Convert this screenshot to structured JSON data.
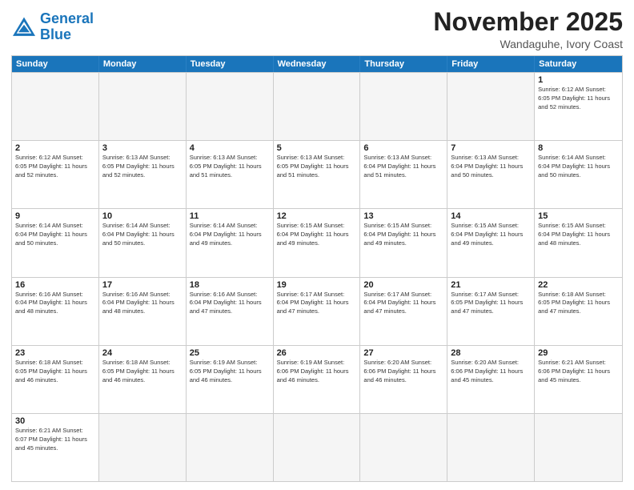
{
  "logo": {
    "line1": "General",
    "line2": "Blue"
  },
  "title": "November 2025",
  "location": "Wandaguhe, Ivory Coast",
  "days": [
    "Sunday",
    "Monday",
    "Tuesday",
    "Wednesday",
    "Thursday",
    "Friday",
    "Saturday"
  ],
  "rows": [
    [
      {
        "day": "",
        "empty": true,
        "info": ""
      },
      {
        "day": "",
        "empty": true,
        "info": ""
      },
      {
        "day": "",
        "empty": true,
        "info": ""
      },
      {
        "day": "",
        "empty": true,
        "info": ""
      },
      {
        "day": "",
        "empty": true,
        "info": ""
      },
      {
        "day": "",
        "empty": true,
        "info": ""
      },
      {
        "day": "1",
        "empty": false,
        "info": "Sunrise: 6:12 AM\nSunset: 6:05 PM\nDaylight: 11 hours\nand 52 minutes."
      }
    ],
    [
      {
        "day": "2",
        "empty": false,
        "info": "Sunrise: 6:12 AM\nSunset: 6:05 PM\nDaylight: 11 hours\nand 52 minutes."
      },
      {
        "day": "3",
        "empty": false,
        "info": "Sunrise: 6:13 AM\nSunset: 6:05 PM\nDaylight: 11 hours\nand 52 minutes."
      },
      {
        "day": "4",
        "empty": false,
        "info": "Sunrise: 6:13 AM\nSunset: 6:05 PM\nDaylight: 11 hours\nand 51 minutes."
      },
      {
        "day": "5",
        "empty": false,
        "info": "Sunrise: 6:13 AM\nSunset: 6:05 PM\nDaylight: 11 hours\nand 51 minutes."
      },
      {
        "day": "6",
        "empty": false,
        "info": "Sunrise: 6:13 AM\nSunset: 6:04 PM\nDaylight: 11 hours\nand 51 minutes."
      },
      {
        "day": "7",
        "empty": false,
        "info": "Sunrise: 6:13 AM\nSunset: 6:04 PM\nDaylight: 11 hours\nand 50 minutes."
      },
      {
        "day": "8",
        "empty": false,
        "info": "Sunrise: 6:14 AM\nSunset: 6:04 PM\nDaylight: 11 hours\nand 50 minutes."
      }
    ],
    [
      {
        "day": "9",
        "empty": false,
        "info": "Sunrise: 6:14 AM\nSunset: 6:04 PM\nDaylight: 11 hours\nand 50 minutes."
      },
      {
        "day": "10",
        "empty": false,
        "info": "Sunrise: 6:14 AM\nSunset: 6:04 PM\nDaylight: 11 hours\nand 50 minutes."
      },
      {
        "day": "11",
        "empty": false,
        "info": "Sunrise: 6:14 AM\nSunset: 6:04 PM\nDaylight: 11 hours\nand 49 minutes."
      },
      {
        "day": "12",
        "empty": false,
        "info": "Sunrise: 6:15 AM\nSunset: 6:04 PM\nDaylight: 11 hours\nand 49 minutes."
      },
      {
        "day": "13",
        "empty": false,
        "info": "Sunrise: 6:15 AM\nSunset: 6:04 PM\nDaylight: 11 hours\nand 49 minutes."
      },
      {
        "day": "14",
        "empty": false,
        "info": "Sunrise: 6:15 AM\nSunset: 6:04 PM\nDaylight: 11 hours\nand 49 minutes."
      },
      {
        "day": "15",
        "empty": false,
        "info": "Sunrise: 6:15 AM\nSunset: 6:04 PM\nDaylight: 11 hours\nand 48 minutes."
      }
    ],
    [
      {
        "day": "16",
        "empty": false,
        "info": "Sunrise: 6:16 AM\nSunset: 6:04 PM\nDaylight: 11 hours\nand 48 minutes."
      },
      {
        "day": "17",
        "empty": false,
        "info": "Sunrise: 6:16 AM\nSunset: 6:04 PM\nDaylight: 11 hours\nand 48 minutes."
      },
      {
        "day": "18",
        "empty": false,
        "info": "Sunrise: 6:16 AM\nSunset: 6:04 PM\nDaylight: 11 hours\nand 47 minutes."
      },
      {
        "day": "19",
        "empty": false,
        "info": "Sunrise: 6:17 AM\nSunset: 6:04 PM\nDaylight: 11 hours\nand 47 minutes."
      },
      {
        "day": "20",
        "empty": false,
        "info": "Sunrise: 6:17 AM\nSunset: 6:04 PM\nDaylight: 11 hours\nand 47 minutes."
      },
      {
        "day": "21",
        "empty": false,
        "info": "Sunrise: 6:17 AM\nSunset: 6:05 PM\nDaylight: 11 hours\nand 47 minutes."
      },
      {
        "day": "22",
        "empty": false,
        "info": "Sunrise: 6:18 AM\nSunset: 6:05 PM\nDaylight: 11 hours\nand 47 minutes."
      }
    ],
    [
      {
        "day": "23",
        "empty": false,
        "info": "Sunrise: 6:18 AM\nSunset: 6:05 PM\nDaylight: 11 hours\nand 46 minutes."
      },
      {
        "day": "24",
        "empty": false,
        "info": "Sunrise: 6:18 AM\nSunset: 6:05 PM\nDaylight: 11 hours\nand 46 minutes."
      },
      {
        "day": "25",
        "empty": false,
        "info": "Sunrise: 6:19 AM\nSunset: 6:05 PM\nDaylight: 11 hours\nand 46 minutes."
      },
      {
        "day": "26",
        "empty": false,
        "info": "Sunrise: 6:19 AM\nSunset: 6:06 PM\nDaylight: 11 hours\nand 46 minutes."
      },
      {
        "day": "27",
        "empty": false,
        "info": "Sunrise: 6:20 AM\nSunset: 6:06 PM\nDaylight: 11 hours\nand 46 minutes."
      },
      {
        "day": "28",
        "empty": false,
        "info": "Sunrise: 6:20 AM\nSunset: 6:06 PM\nDaylight: 11 hours\nand 45 minutes."
      },
      {
        "day": "29",
        "empty": false,
        "info": "Sunrise: 6:21 AM\nSunset: 6:06 PM\nDaylight: 11 hours\nand 45 minutes."
      }
    ],
    [
      {
        "day": "30",
        "empty": false,
        "info": "Sunrise: 6:21 AM\nSunset: 6:07 PM\nDaylight: 11 hours\nand 45 minutes."
      },
      {
        "day": "",
        "empty": true,
        "info": ""
      },
      {
        "day": "",
        "empty": true,
        "info": ""
      },
      {
        "day": "",
        "empty": true,
        "info": ""
      },
      {
        "day": "",
        "empty": true,
        "info": ""
      },
      {
        "day": "",
        "empty": true,
        "info": ""
      },
      {
        "day": "",
        "empty": true,
        "info": ""
      }
    ]
  ]
}
